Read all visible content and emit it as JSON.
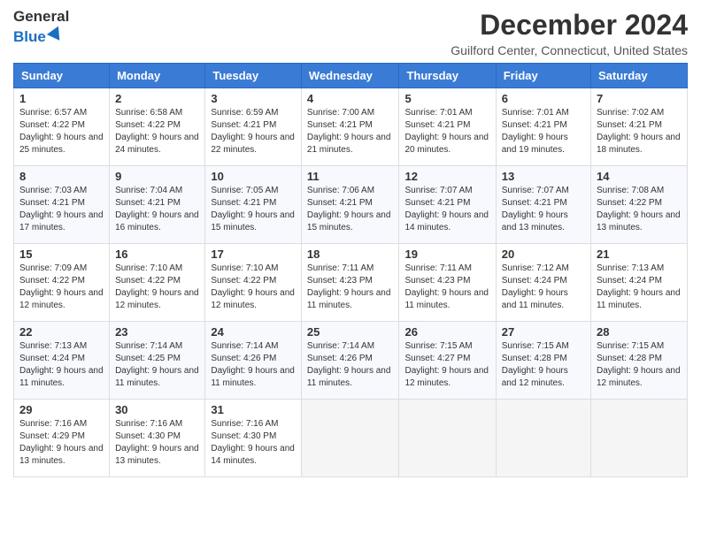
{
  "logo": {
    "line1": "General",
    "line2": "Blue"
  },
  "title": "December 2024",
  "subtitle": "Guilford Center, Connecticut, United States",
  "weekdays": [
    "Sunday",
    "Monday",
    "Tuesday",
    "Wednesday",
    "Thursday",
    "Friday",
    "Saturday"
  ],
  "weeks": [
    [
      {
        "day": "1",
        "sunrise": "6:57 AM",
        "sunset": "4:22 PM",
        "daylight": "9 hours and 25 minutes."
      },
      {
        "day": "2",
        "sunrise": "6:58 AM",
        "sunset": "4:22 PM",
        "daylight": "9 hours and 24 minutes."
      },
      {
        "day": "3",
        "sunrise": "6:59 AM",
        "sunset": "4:21 PM",
        "daylight": "9 hours and 22 minutes."
      },
      {
        "day": "4",
        "sunrise": "7:00 AM",
        "sunset": "4:21 PM",
        "daylight": "9 hours and 21 minutes."
      },
      {
        "day": "5",
        "sunrise": "7:01 AM",
        "sunset": "4:21 PM",
        "daylight": "9 hours and 20 minutes."
      },
      {
        "day": "6",
        "sunrise": "7:01 AM",
        "sunset": "4:21 PM",
        "daylight": "9 hours and 19 minutes."
      },
      {
        "day": "7",
        "sunrise": "7:02 AM",
        "sunset": "4:21 PM",
        "daylight": "9 hours and 18 minutes."
      }
    ],
    [
      {
        "day": "8",
        "sunrise": "7:03 AM",
        "sunset": "4:21 PM",
        "daylight": "9 hours and 17 minutes."
      },
      {
        "day": "9",
        "sunrise": "7:04 AM",
        "sunset": "4:21 PM",
        "daylight": "9 hours and 16 minutes."
      },
      {
        "day": "10",
        "sunrise": "7:05 AM",
        "sunset": "4:21 PM",
        "daylight": "9 hours and 15 minutes."
      },
      {
        "day": "11",
        "sunrise": "7:06 AM",
        "sunset": "4:21 PM",
        "daylight": "9 hours and 15 minutes."
      },
      {
        "day": "12",
        "sunrise": "7:07 AM",
        "sunset": "4:21 PM",
        "daylight": "9 hours and 14 minutes."
      },
      {
        "day": "13",
        "sunrise": "7:07 AM",
        "sunset": "4:21 PM",
        "daylight": "9 hours and 13 minutes."
      },
      {
        "day": "14",
        "sunrise": "7:08 AM",
        "sunset": "4:22 PM",
        "daylight": "9 hours and 13 minutes."
      }
    ],
    [
      {
        "day": "15",
        "sunrise": "7:09 AM",
        "sunset": "4:22 PM",
        "daylight": "9 hours and 12 minutes."
      },
      {
        "day": "16",
        "sunrise": "7:10 AM",
        "sunset": "4:22 PM",
        "daylight": "9 hours and 12 minutes."
      },
      {
        "day": "17",
        "sunrise": "7:10 AM",
        "sunset": "4:22 PM",
        "daylight": "9 hours and 12 minutes."
      },
      {
        "day": "18",
        "sunrise": "7:11 AM",
        "sunset": "4:23 PM",
        "daylight": "9 hours and 11 minutes."
      },
      {
        "day": "19",
        "sunrise": "7:11 AM",
        "sunset": "4:23 PM",
        "daylight": "9 hours and 11 minutes."
      },
      {
        "day": "20",
        "sunrise": "7:12 AM",
        "sunset": "4:24 PM",
        "daylight": "9 hours and 11 minutes."
      },
      {
        "day": "21",
        "sunrise": "7:13 AM",
        "sunset": "4:24 PM",
        "daylight": "9 hours and 11 minutes."
      }
    ],
    [
      {
        "day": "22",
        "sunrise": "7:13 AM",
        "sunset": "4:24 PM",
        "daylight": "9 hours and 11 minutes."
      },
      {
        "day": "23",
        "sunrise": "7:14 AM",
        "sunset": "4:25 PM",
        "daylight": "9 hours and 11 minutes."
      },
      {
        "day": "24",
        "sunrise": "7:14 AM",
        "sunset": "4:26 PM",
        "daylight": "9 hours and 11 minutes."
      },
      {
        "day": "25",
        "sunrise": "7:14 AM",
        "sunset": "4:26 PM",
        "daylight": "9 hours and 11 minutes."
      },
      {
        "day": "26",
        "sunrise": "7:15 AM",
        "sunset": "4:27 PM",
        "daylight": "9 hours and 12 minutes."
      },
      {
        "day": "27",
        "sunrise": "7:15 AM",
        "sunset": "4:28 PM",
        "daylight": "9 hours and 12 minutes."
      },
      {
        "day": "28",
        "sunrise": "7:15 AM",
        "sunset": "4:28 PM",
        "daylight": "9 hours and 12 minutes."
      }
    ],
    [
      {
        "day": "29",
        "sunrise": "7:16 AM",
        "sunset": "4:29 PM",
        "daylight": "9 hours and 13 minutes."
      },
      {
        "day": "30",
        "sunrise": "7:16 AM",
        "sunset": "4:30 PM",
        "daylight": "9 hours and 13 minutes."
      },
      {
        "day": "31",
        "sunrise": "7:16 AM",
        "sunset": "4:30 PM",
        "daylight": "9 hours and 14 minutes."
      },
      null,
      null,
      null,
      null
    ]
  ],
  "labels": {
    "sunrise": "Sunrise:",
    "sunset": "Sunset:",
    "daylight": "Daylight:"
  }
}
